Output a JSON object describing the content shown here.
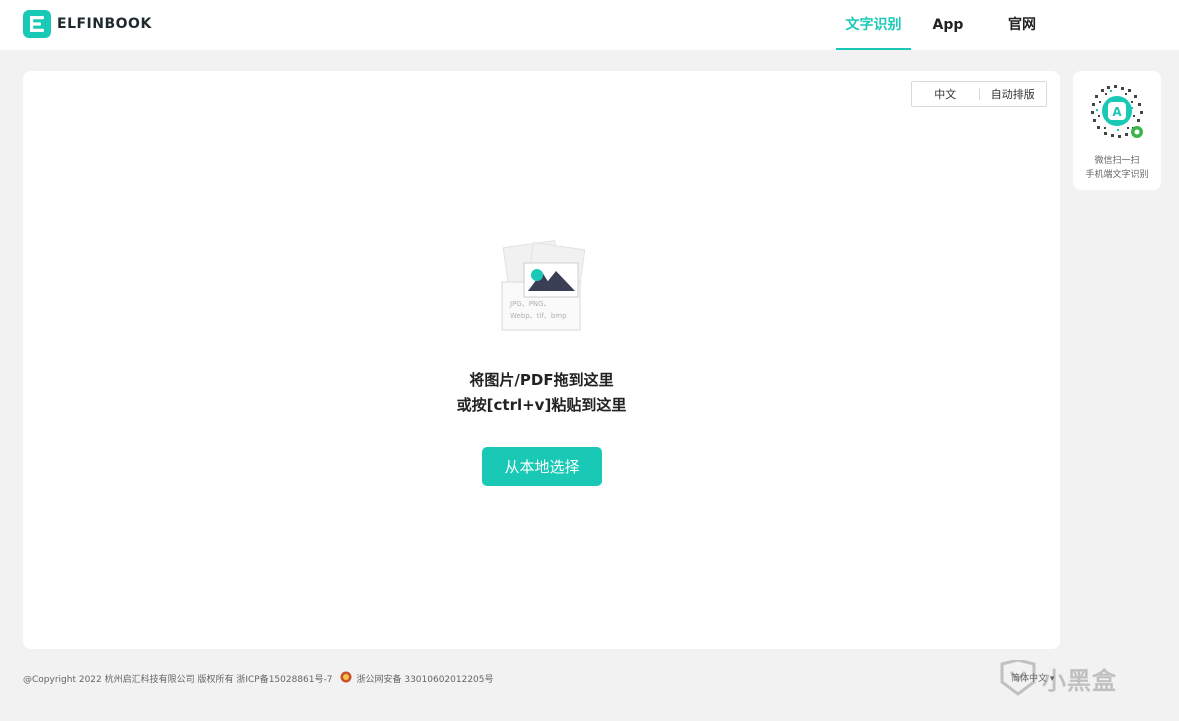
{
  "header": {
    "logo_text": "ELFINBOOK",
    "nav": [
      {
        "label": "文字识别",
        "active": true
      },
      {
        "label": "App",
        "active": false
      },
      {
        "label": "官网",
        "active": false
      }
    ]
  },
  "main": {
    "language_option": "中文",
    "layout_option": "自动排版",
    "supported_formats_line1": "JPG、PNG、",
    "supported_formats_line2": "Webp、tif、bmp",
    "drop_hint": "将图片/PDF拖到这里",
    "paste_hint": "或按[ctrl+v]粘贴到这里",
    "choose_button": "从本地选择"
  },
  "qr": {
    "line1": "微信扫一扫",
    "line2": "手机端文字识别",
    "badge_letter": "A"
  },
  "footer": {
    "copyright": "@Copyright 2022 杭州启汇科技有限公司 版权所有 浙ICP备15028861号-7",
    "police_record": "浙公网安备 33010602012205号",
    "language_switch": "简体中文",
    "language_switch_arrow": "▾"
  },
  "watermark": {
    "text": "小黑盒"
  },
  "colors": {
    "accent": "#19c9b6",
    "background": "#f2f2f2"
  },
  "icons": {
    "logo": "elfinbook-logo-icon",
    "upload": "image-file-icon",
    "police": "police-badge-icon",
    "qr": "qr-code-icon"
  }
}
